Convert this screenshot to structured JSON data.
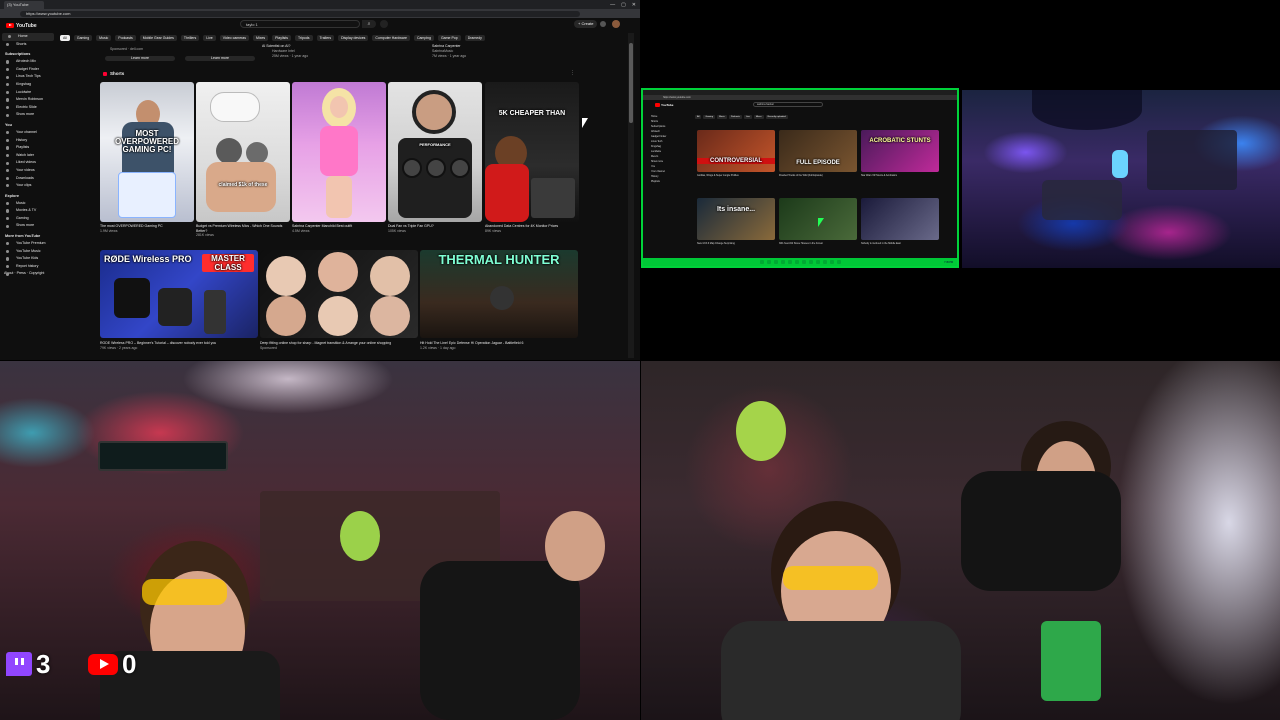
{
  "browser": {
    "tab_title": "(3) YouTube",
    "url": "https://www.youtube.com",
    "window_controls": [
      "—",
      "▢",
      "✕"
    ]
  },
  "youtube": {
    "logo_text": "YouTube",
    "search_value": "taylo 1",
    "create_label": "+ Create",
    "sidebar": {
      "top": [
        "Home",
        "Shorts"
      ],
      "subscriptions_header": "Subscriptions",
      "subscriptions": [
        "Afrotech Mix",
        "Gadget Finder",
        "Linus Tech Tips",
        "Kingshag",
        "Lucidwire",
        "Mervin Robinson",
        "Electric Slide",
        "Show more"
      ],
      "you_header": "You",
      "you": [
        "Your channel",
        "History",
        "Playlists",
        "Watch later",
        "Liked videos",
        "Your videos",
        "Downloads",
        "Your clips"
      ],
      "explore_header": "Explore",
      "explore": [
        "Music",
        "Movies & TV",
        "Gaming",
        "Show more"
      ],
      "more_header": "More from YouTube",
      "more": [
        "YouTube Premium",
        "YouTube Music",
        "YouTube Kids"
      ],
      "footer": [
        "Report history",
        "About · Press · Copyright",
        "Contact us · Creators · Advertise"
      ]
    },
    "chips": [
      "All",
      "Gaming",
      "Music",
      "Podcasts",
      "Mobile Gear Guides",
      "Thrillers",
      "Live",
      "Video cameras",
      "Mixes",
      "Playlists",
      "Tripods",
      "Trailers",
      "Display devices",
      "Computer Hardware",
      "Camping",
      "Game Pop",
      "Dramedy",
      "History",
      "Recently uploaded",
      "Watched",
      "New to you"
    ],
    "top_row": {
      "sponsored_left": "Sponsored · dell.com",
      "btn_left": "Learn more",
      "btn_right": "Learn more",
      "center_title": "AI Scientist on AI?",
      "center_meta": "Hardware Intel",
      "center_views": "25M views · 1 year ago",
      "right_title": "Sabrina Carpenter",
      "right_meta": "SabrinaMusic",
      "right_views": "7M views · 1 year ago"
    },
    "shorts_header": "Shorts",
    "shorts": [
      {
        "overlay": "MOST OVERPOWERED GAMING PC!",
        "title": "The most OVERPOWERED Gaming PC",
        "views": "1.9M views"
      },
      {
        "overlay": "claimed $1k of these",
        "title": "Budget vs Premium Wireless Mics - Which One Sounds Better?",
        "views": "281K views"
      },
      {
        "overlay": "",
        "title": "Sabrina Carpenter Manchild Best outfit",
        "views": "4.5M views"
      },
      {
        "overlay": "PERFORMANCE",
        "title": "Dual Fan vs Triple Fan GPU?",
        "views": "105K views"
      },
      {
        "overlay": "5K CHEAPER THAN",
        "title": "Abandoned Data Centres for 4K Monitor Prices",
        "views": "89K views"
      }
    ],
    "videos": [
      {
        "overlay_top": "RØDE Wireless PRO",
        "overlay_badge": "MASTER CLASS",
        "title": "RODE Wireless PRO – Beginner's Tutorial – discover nobody ever told you",
        "meta": "79K views · 2 years ago"
      },
      {
        "overlay_top": "",
        "overlay_badge": "",
        "title": "Deep fitting online shop for sharp - Magnet transition & Arrange your online shopping",
        "meta": "Sponsored"
      },
      {
        "overlay_top": "THERMAL HUNTER",
        "overlay_badge": "",
        "title": "Hit Hold The Line! Epic Defense Hi Operation Jaguar - Battlefield 6",
        "meta": "1.2K views · 1 day ago"
      }
    ]
  },
  "monitor2": {
    "url": "https://www.youtube.com",
    "search_value": "sabrina hacker",
    "logo_text": "YouTube",
    "sidebar": [
      "Home",
      "Shorts",
      "Subscriptions",
      "Afrotech",
      "Gadget Finder",
      "Linus Tech",
      "Kingshag",
      "Lucidwire",
      "Mervin",
      "Show more",
      "You",
      "Your channel",
      "History",
      "Playlists"
    ],
    "chips": [
      "All",
      "Gaming",
      "Music",
      "Podcasts",
      "Live",
      "Mixes",
      "Recently uploaded"
    ],
    "thumbs": [
      {
        "overlay": "CONTROVERSIAL",
        "caption": "Gorillas, Wings & Super Jungle Profiles"
      },
      {
        "overlay": "FULL EPISODE",
        "caption": "Flooded Tracks of the Wild (Full Episode)"
      },
      {
        "overlay": "ACROBATIC STUNTS",
        "caption": "Star Wars VR Stunts & Acrobatics"
      },
      {
        "overlay": "Its insane...",
        "caption": "New GTA 6 Map Change Surprising"
      },
      {
        "overlay": "",
        "caption": "300-Year-Old Stone Houses in the Forest"
      },
      {
        "overlay": "",
        "caption": "Nobody is involved in the Middle East"
      }
    ],
    "clock": "7:45 PM"
  },
  "overlay_counters": {
    "twitch_count": "3",
    "youtube_count": "0"
  },
  "colors": {
    "youtube_red": "#ff0000",
    "twitch_purple": "#9146ff",
    "monitor_green": "#00d23a",
    "yt_dark": "#0f0f0f"
  }
}
